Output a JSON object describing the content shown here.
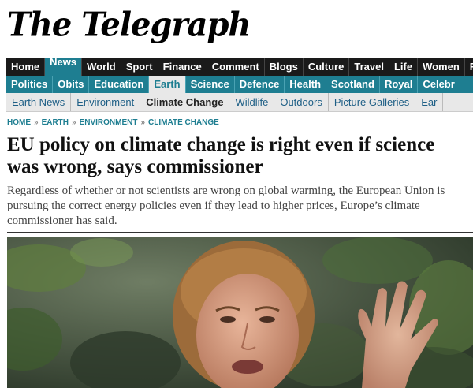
{
  "masthead": {
    "logo_text": "The Telegraph"
  },
  "nav_primary": [
    {
      "label": "Home"
    },
    {
      "label": "News",
      "active": true
    },
    {
      "label": "World"
    },
    {
      "label": "Sport"
    },
    {
      "label": "Finance"
    },
    {
      "label": "Comment"
    },
    {
      "label": "Blogs"
    },
    {
      "label": "Culture"
    },
    {
      "label": "Travel"
    },
    {
      "label": "Life"
    },
    {
      "label": "Women"
    },
    {
      "label": "Fa"
    }
  ],
  "nav_secondary": [
    {
      "label": "Politics"
    },
    {
      "label": "Obits"
    },
    {
      "label": "Education"
    },
    {
      "label": "Earth",
      "active": true
    },
    {
      "label": "Science"
    },
    {
      "label": "Defence"
    },
    {
      "label": "Health"
    },
    {
      "label": "Scotland"
    },
    {
      "label": "Royal"
    },
    {
      "label": "Celebr"
    }
  ],
  "nav_tertiary": [
    {
      "label": "Earth News"
    },
    {
      "label": "Environment"
    },
    {
      "label": "Climate Change",
      "active": true
    },
    {
      "label": "Wildlife"
    },
    {
      "label": "Outdoors"
    },
    {
      "label": "Picture Galleries"
    },
    {
      "label": "Ear"
    }
  ],
  "breadcrumb": {
    "items": [
      "HOME",
      "EARTH",
      "ENVIRONMENT",
      "CLIMATE CHANGE"
    ],
    "separator": "»"
  },
  "article": {
    "headline": "EU policy on climate change is right even if science was wrong, says commissioner",
    "standfirst": "Regardless of whether or not scientists are wrong on global warming, the European Union is pursuing the correct energy policies even if they lead to higher prices, Europe’s climate commissioner has said."
  },
  "colors": {
    "nav_dark": "#1a1a1a",
    "accent_teal": "#1e7e91",
    "nav_light": "#e8e8e8",
    "link_blue": "#1e5f86"
  }
}
